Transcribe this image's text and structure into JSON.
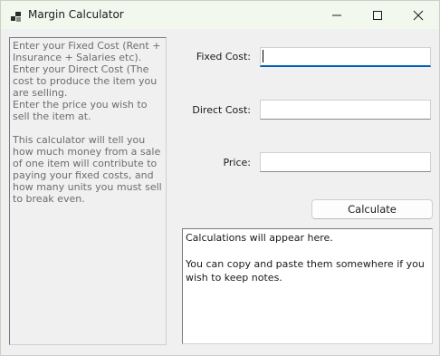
{
  "window": {
    "title": "Margin Calculator"
  },
  "instructions": {
    "text": "Enter your Fixed Cost (Rent + Insurance + Salaries etc).\nEnter your Direct Cost (The cost to produce the item you are selling.\nEnter the price you wish to sell the item at.\n\nThis calculator will tell you how much money from a sale of one item will contribute to paying your fixed costs, and how many units you must sell to break even."
  },
  "form": {
    "fixed_cost": {
      "label": "Fixed Cost:",
      "value": ""
    },
    "direct_cost": {
      "label": "Direct Cost:",
      "value": ""
    },
    "price": {
      "label": "Price:",
      "value": ""
    }
  },
  "calculate_button": {
    "label": "Calculate"
  },
  "output": {
    "text": "Calculations will appear here.\n\nYou can copy and paste them somewhere if you wish to keep notes."
  },
  "icons": {
    "app": "app-icon",
    "minimize": "minimize-icon",
    "maximize": "maximize-icon",
    "close": "close-icon"
  },
  "colors": {
    "focus_accent": "#005fb8",
    "titlebar": "#f3f8ef",
    "client_bg": "#f0f0f0"
  }
}
